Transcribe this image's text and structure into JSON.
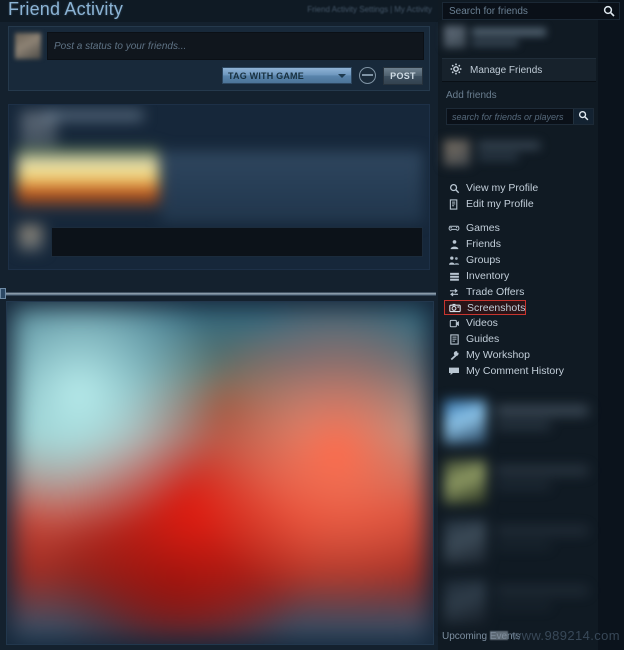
{
  "header": {
    "title": "Friend Activity",
    "links": [
      {
        "label": "Friend Activity Settings"
      },
      {
        "label": "My Activity"
      }
    ],
    "separator": "|"
  },
  "composer": {
    "placeholder": "Post a status to your friends...",
    "value": "",
    "tag_with_game_label": "TAG WITH GAME",
    "post_label": "POST"
  },
  "sidebar": {
    "friend_search_placeholder": "Search for friends",
    "friend_search_value": "",
    "manage_friends_label": "Manage Friends",
    "add_friends_label": "Add friends",
    "add_friends_placeholder": "search for friends or players",
    "add_friends_value": "",
    "profile_links": [
      {
        "label": "View my Profile",
        "icon": "magnifier-icon"
      },
      {
        "label": "Edit my Profile",
        "icon": "document-edit-icon"
      }
    ],
    "nav_items": [
      {
        "label": "Games",
        "icon": "controller-icon",
        "highlighted": false
      },
      {
        "label": "Friends",
        "icon": "person-icon",
        "highlighted": false
      },
      {
        "label": "Groups",
        "icon": "group-icon",
        "highlighted": false
      },
      {
        "label": "Inventory",
        "icon": "inventory-icon",
        "highlighted": false
      },
      {
        "label": "Trade Offers",
        "icon": "trade-icon",
        "highlighted": false
      },
      {
        "label": "Screenshots",
        "icon": "camera-icon",
        "highlighted": true
      },
      {
        "label": "Videos",
        "icon": "video-icon",
        "highlighted": false
      },
      {
        "label": "Guides",
        "icon": "guide-icon",
        "highlighted": false
      },
      {
        "label": "My Workshop",
        "icon": "wrench-icon",
        "highlighted": false
      },
      {
        "label": "My Comment History",
        "icon": "comment-icon",
        "highlighted": false
      }
    ],
    "upcoming_events_label": "Upcoming Events"
  },
  "watermark": {
    "text": "www.989214.com"
  },
  "colors": {
    "page_background": "#0f1a23",
    "main_panel": "#14212e",
    "sidebar_panel": "#101a23",
    "title_blue": "#8bb3d4",
    "highlight_red": "#c8352f",
    "tag_button_blue": "#6d96bd",
    "nav_text": "#c2ced9"
  }
}
